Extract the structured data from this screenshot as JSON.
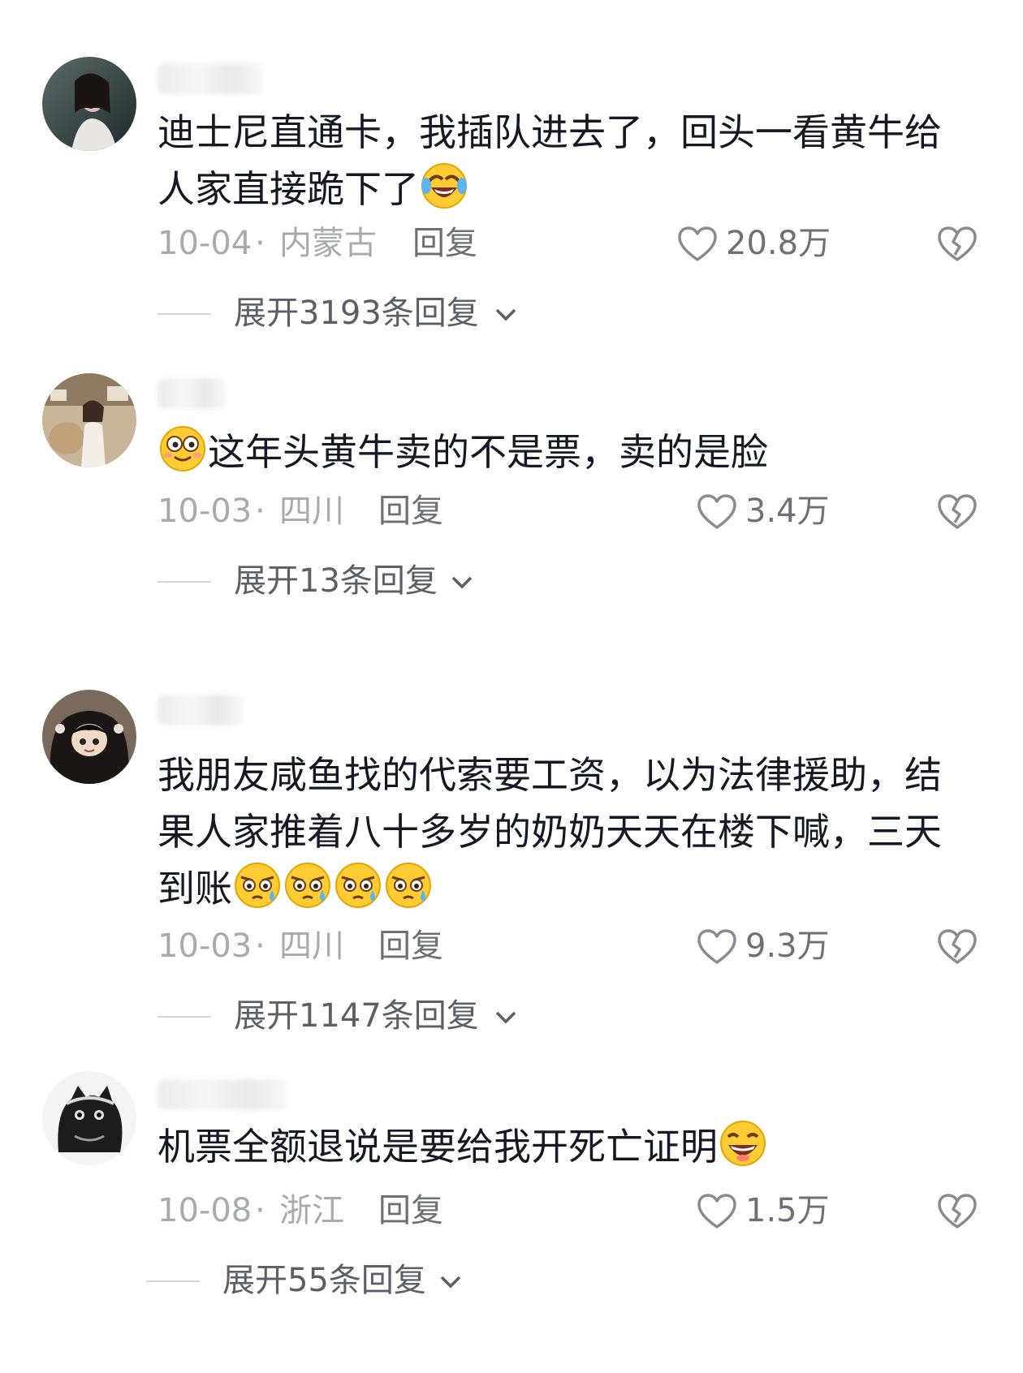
{
  "comments": [
    {
      "text": "迪士尼直通卡，我插队进去了，回头一看黄牛给人家直接跪下了",
      "trailing_emoji": "crying-laughing-emoji",
      "date": "10-04",
      "location": "内蒙古",
      "reply_label": "回复",
      "likes": "20.8万",
      "expand_label": "展开3193条回复"
    },
    {
      "text": "这年头黄牛卖的不是票，卖的是脸",
      "leading_emoji": "flushed-smile-emoji",
      "date": "10-03",
      "location": "四川",
      "reply_label": "回复",
      "likes": "3.4万",
      "expand_label": "展开13条回复"
    },
    {
      "text": "我朋友咸鱼找的代索要工资，以为法律援助，结果人家推着八十多岁的奶奶天天在楼下喊，三天到账",
      "trailing_emoji": "teary-eyed-emoji x4",
      "date": "10-03",
      "location": "四川",
      "reply_label": "回复",
      "likes": "9.3万",
      "expand_label": "展开1147条回复"
    },
    {
      "text": "机票全额退说是要给我开死亡证明",
      "trailing_emoji": "grinning-emoji",
      "date": "10-08",
      "location": "浙江",
      "reply_label": "回复",
      "likes": "1.5万",
      "expand_label": "展开55条回复"
    }
  ],
  "separator": "·",
  "colors": {
    "text": "#161823",
    "meta": "#a9aaae",
    "secondary": "#6f7076",
    "emoji_yellow": "#ffcc33"
  }
}
